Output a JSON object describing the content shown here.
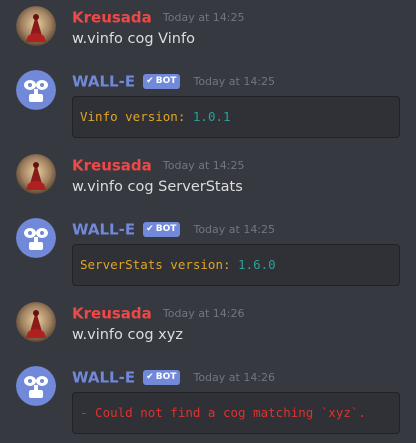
{
  "messages": [
    {
      "author": "Kreusada",
      "is_bot": false,
      "timestamp": "Today at 14:25",
      "text": "w.vinfo cog Vinfo"
    },
    {
      "author": "WALL-E",
      "is_bot": true,
      "bot_tag": "BOT",
      "timestamp": "Today at 14:25",
      "code_key": "Vinfo version: ",
      "code_value": "1.0.1"
    },
    {
      "author": "Kreusada",
      "is_bot": false,
      "timestamp": "Today at 14:25",
      "text": "w.vinfo cog ServerStats"
    },
    {
      "author": "WALL-E",
      "is_bot": true,
      "bot_tag": "BOT",
      "timestamp": "Today at 14:25",
      "code_key": "ServerStats version: ",
      "code_value": "1.6.0"
    },
    {
      "author": "Kreusada",
      "is_bot": false,
      "timestamp": "Today at 14:26",
      "text": "w.vinfo cog xyz"
    },
    {
      "author": "WALL-E",
      "is_bot": true,
      "bot_tag": "BOT",
      "timestamp": "Today at 14:26",
      "code_error": "- Could not find a cog matching `xyz`."
    }
  ],
  "icons": {
    "user_avatar": "user-avatar-icon",
    "bot_avatar": "robot-icon",
    "verified_check": "check-icon"
  },
  "colors": {
    "background": "#36393f",
    "user_name": "#f04747",
    "bot_name": "#7289da",
    "bot_tag": "#7289da",
    "code_key": "#e0a526",
    "code_value": "#2aa198",
    "code_error": "#dc322f"
  }
}
